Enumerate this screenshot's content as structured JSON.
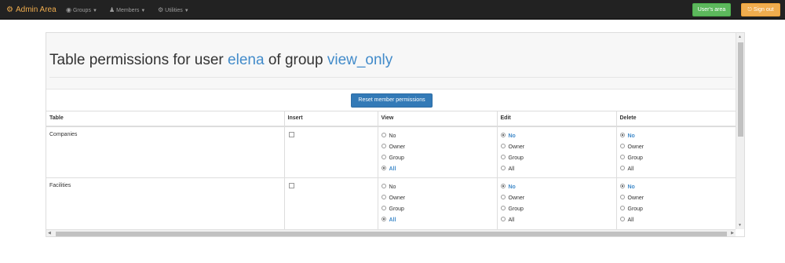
{
  "navbar": {
    "brand": "Admin Area",
    "brand_icon": "gear-icon",
    "items": [
      {
        "label": "Groups",
        "icon": "globe-icon"
      },
      {
        "label": "Members",
        "icon": "user-icon"
      },
      {
        "label": "Utilities",
        "icon": "cog-icon"
      }
    ],
    "users_area_label": "User's area",
    "sign_out_label": "Sign out"
  },
  "page": {
    "title_prefix": "Table permissions for user",
    "user": "elena",
    "title_mid": "of group",
    "group": "view_only",
    "reset_label": "Reset member permissions"
  },
  "table": {
    "headers": [
      "Table",
      "Insert",
      "View",
      "Edit",
      "Delete"
    ],
    "options": [
      "No",
      "Owner",
      "Group",
      "All"
    ],
    "rows": [
      {
        "name": "Companies",
        "insert_checked": false,
        "view": "All",
        "edit": "No",
        "delete": "No"
      },
      {
        "name": "Facilities",
        "insert_checked": false,
        "view": "All",
        "edit": "No",
        "delete": "No"
      }
    ]
  },
  "colors": {
    "navbar_bg": "#222222",
    "brand": "#f0ad4e",
    "accent_blue": "#428bca",
    "success": "#5cb85c",
    "warning": "#f0ad4e",
    "primary_button": "#337ab7"
  }
}
